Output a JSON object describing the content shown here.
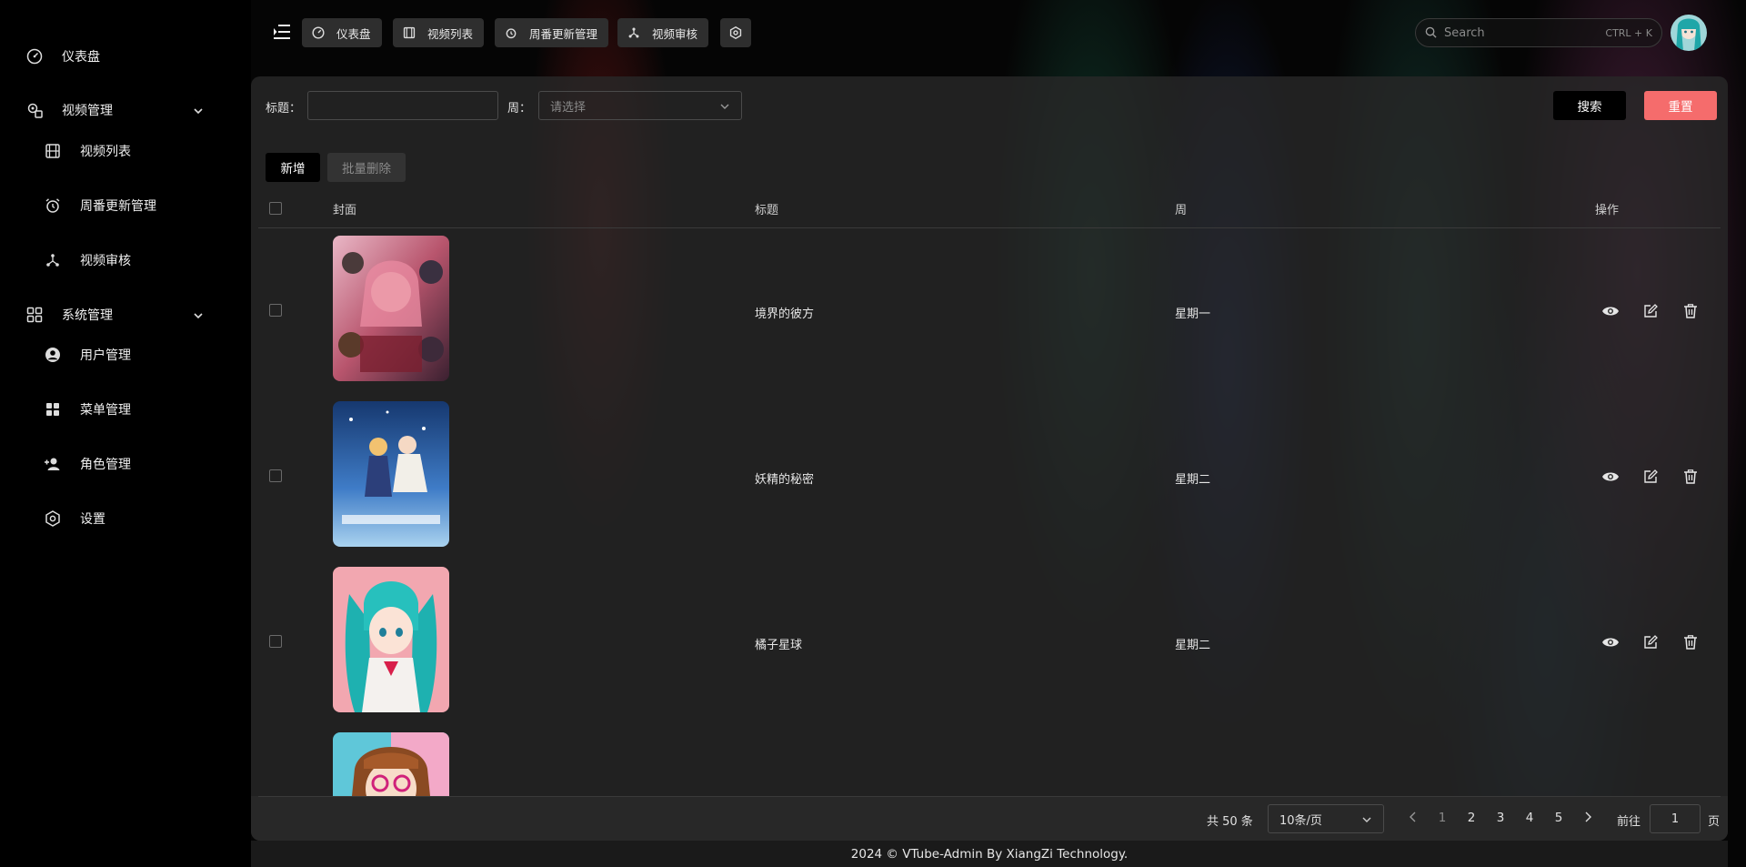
{
  "sidebar": {
    "items": [
      {
        "label": "仪表盘",
        "icon": "dashboard-icon"
      },
      {
        "label": "视频管理",
        "icon": "settings-group-icon",
        "expanded": true
      },
      {
        "label": "视频列表",
        "icon": "film-icon"
      },
      {
        "label": "周番更新管理",
        "icon": "alarm-clock-icon"
      },
      {
        "label": "视频审核",
        "icon": "network-icon"
      },
      {
        "label": "系统管理",
        "icon": "grid-icon",
        "expanded": true
      },
      {
        "label": "用户管理",
        "icon": "user-circle-icon"
      },
      {
        "label": "菜单管理",
        "icon": "apps-icon"
      },
      {
        "label": "角色管理",
        "icon": "add-user-icon"
      },
      {
        "label": "设置",
        "icon": "gear-icon"
      }
    ]
  },
  "topbar": {
    "tabs": [
      {
        "label": "仪表盘",
        "icon": "dashboard-icon"
      },
      {
        "label": "视频列表",
        "icon": "film-icon"
      },
      {
        "label": "周番更新管理",
        "icon": "alarm-clock-icon"
      },
      {
        "label": "视频审核",
        "icon": "network-icon"
      },
      {
        "label": "",
        "icon": "gear-icon"
      }
    ],
    "search": {
      "placeholder": "Search",
      "shortcut": "CTRL + K"
    }
  },
  "filters": {
    "title_label": "标题：",
    "title_value": "",
    "week_label": "周：",
    "week_placeholder": "请选择",
    "search_button": "搜索",
    "reset_button": "重置"
  },
  "toolbar": {
    "add_button": "新增",
    "batch_delete_button": "批量删除"
  },
  "table": {
    "columns": [
      "封面",
      "标题",
      "周",
      "操作"
    ],
    "rows": [
      {
        "title": "境界的彼方",
        "week": "星期一"
      },
      {
        "title": "妖精的秘密",
        "week": "星期二"
      },
      {
        "title": "橘子星球",
        "week": "星期二"
      },
      {
        "title": "",
        "week": ""
      }
    ]
  },
  "pagination": {
    "total": "共 50 条",
    "page_size": "10条/页",
    "pages": [
      "1",
      "2",
      "3",
      "4",
      "5"
    ],
    "current_page": "1",
    "goto_label": "前往",
    "goto_value": "1",
    "page_suffix": "页"
  },
  "footer": {
    "text": "2024 © VTube-Admin By XiangZi Technology."
  },
  "colors": {
    "accent": "#f56c6c",
    "panel": "#282828",
    "background": "#000000"
  }
}
